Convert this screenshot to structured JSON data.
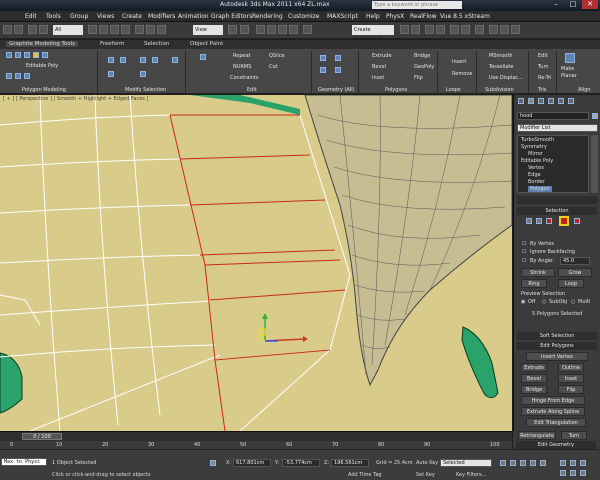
{
  "window": {
    "title": "Autodesk 3ds Max  2011 x64        ZL.max",
    "search_placeholder": "Type a keyword or phrase"
  },
  "menu": [
    "Edit",
    "Tools",
    "Group",
    "Views",
    "Create",
    "Modifiers",
    "Animation",
    "Graph Editors",
    "Rendering",
    "Customize",
    "MAXScript",
    "Help",
    "PhysX",
    "RealFlow",
    "Vue 8.5 xStream"
  ],
  "toolbar": {
    "selection_filter": "All",
    "ref_coord": "View",
    "named_selection": "Create Selection Se"
  },
  "ribbon": {
    "tabs": [
      "Graphite Modeling Tools",
      "Freeform",
      "Selection",
      "Object Paint"
    ],
    "object_type": "Editable Poly",
    "groups": [
      "Polygon Modeling",
      "Modify Selection",
      "Edit",
      "Geometry (All)",
      "Polygons",
      "Loops",
      "Subdivision",
      "Tris",
      "Align"
    ],
    "edit_items": [
      "Repeat",
      "QSlice",
      "NURMS",
      "Cut",
      "Constraints"
    ],
    "polygon_items": [
      "Extrude",
      "Bridge",
      "Bevel",
      "GeoPoly",
      "Inset",
      "Flip"
    ],
    "loop_items": [
      "Insert",
      "Remove"
    ],
    "subdiv_items": [
      "MSmooth",
      "Tessellate",
      "Use Displac..."
    ],
    "tris_items": [
      "Edit",
      "Turn",
      "Re-Tri"
    ],
    "align_items": [
      "Make",
      "Planar"
    ]
  },
  "viewport": {
    "label": "[ + ] [ Perspective ] [ Smooth + Highlight + Edged Faces ]"
  },
  "command_panel": {
    "object_name": "hood",
    "modifier_list": "Modifier List",
    "stack": [
      "TurboSmooth",
      "Symmetry",
      "Mirror",
      "Editable Poly",
      "Vertex",
      "Edge",
      "Border",
      "Polygon"
    ],
    "selection_title": "Selection",
    "by_vertex": "By Vertex",
    "ignore_backfacing": "Ignore Backfacing",
    "by_angle": "By Angle:",
    "by_angle_value": "45.0",
    "shrink": "Shrink",
    "grow": "Grow",
    "ring": "Ring",
    "loop": "Loop",
    "preview_selection": "Preview Selection",
    "preview_options": [
      "Off",
      "SubObj",
      "Multi"
    ],
    "status": "5 Polygons Selected",
    "soft_selection": "Soft Selection",
    "edit_polygons": "Edit Polygons",
    "insert_vertex": "Insert Vertex",
    "extrude": "Extrude",
    "outline": "Outline",
    "bevel": "Bevel",
    "inset": "Inset",
    "bridge": "Bridge",
    "flip": "Flip",
    "hinge_from_edge": "Hinge From Edge",
    "extrude_along_spline": "Extrude Along Spline",
    "edit_triangulation": "Edit Triangulation",
    "retriangulate": "Retriangulate",
    "turn": "Turn",
    "edit_geometry": "Edit Geometry"
  },
  "timeline": {
    "frame": "0 / 100",
    "ticks": [
      "0",
      "10",
      "20",
      "30",
      "40",
      "50",
      "60",
      "70",
      "80",
      "90",
      "100"
    ]
  },
  "statusbar": {
    "maxscript": "Max to Physc",
    "selection_count": "1 Object Selected",
    "prompt": "Click or click-and-drag to select objects",
    "x_label": "X:",
    "x_value": "617.801cm",
    "y_label": "Y:",
    "y_value": "-53.774cm",
    "z_label": "Z:",
    "z_value": "196.561cm",
    "grid": "Grid = 25.4cm",
    "add_time_tag": "Add Time Tag",
    "auto_key": "Auto Key",
    "set_key": "Set Key",
    "selected": "Selected",
    "key_filters": "Key Filters..."
  },
  "colors": {
    "viewport_bg": "#d9cc8a",
    "mesh_wire": "#ffffff",
    "selected_edge": "#c8281e",
    "green_part": "#2aa36a",
    "panel_bg": "#3b3b3b"
  }
}
